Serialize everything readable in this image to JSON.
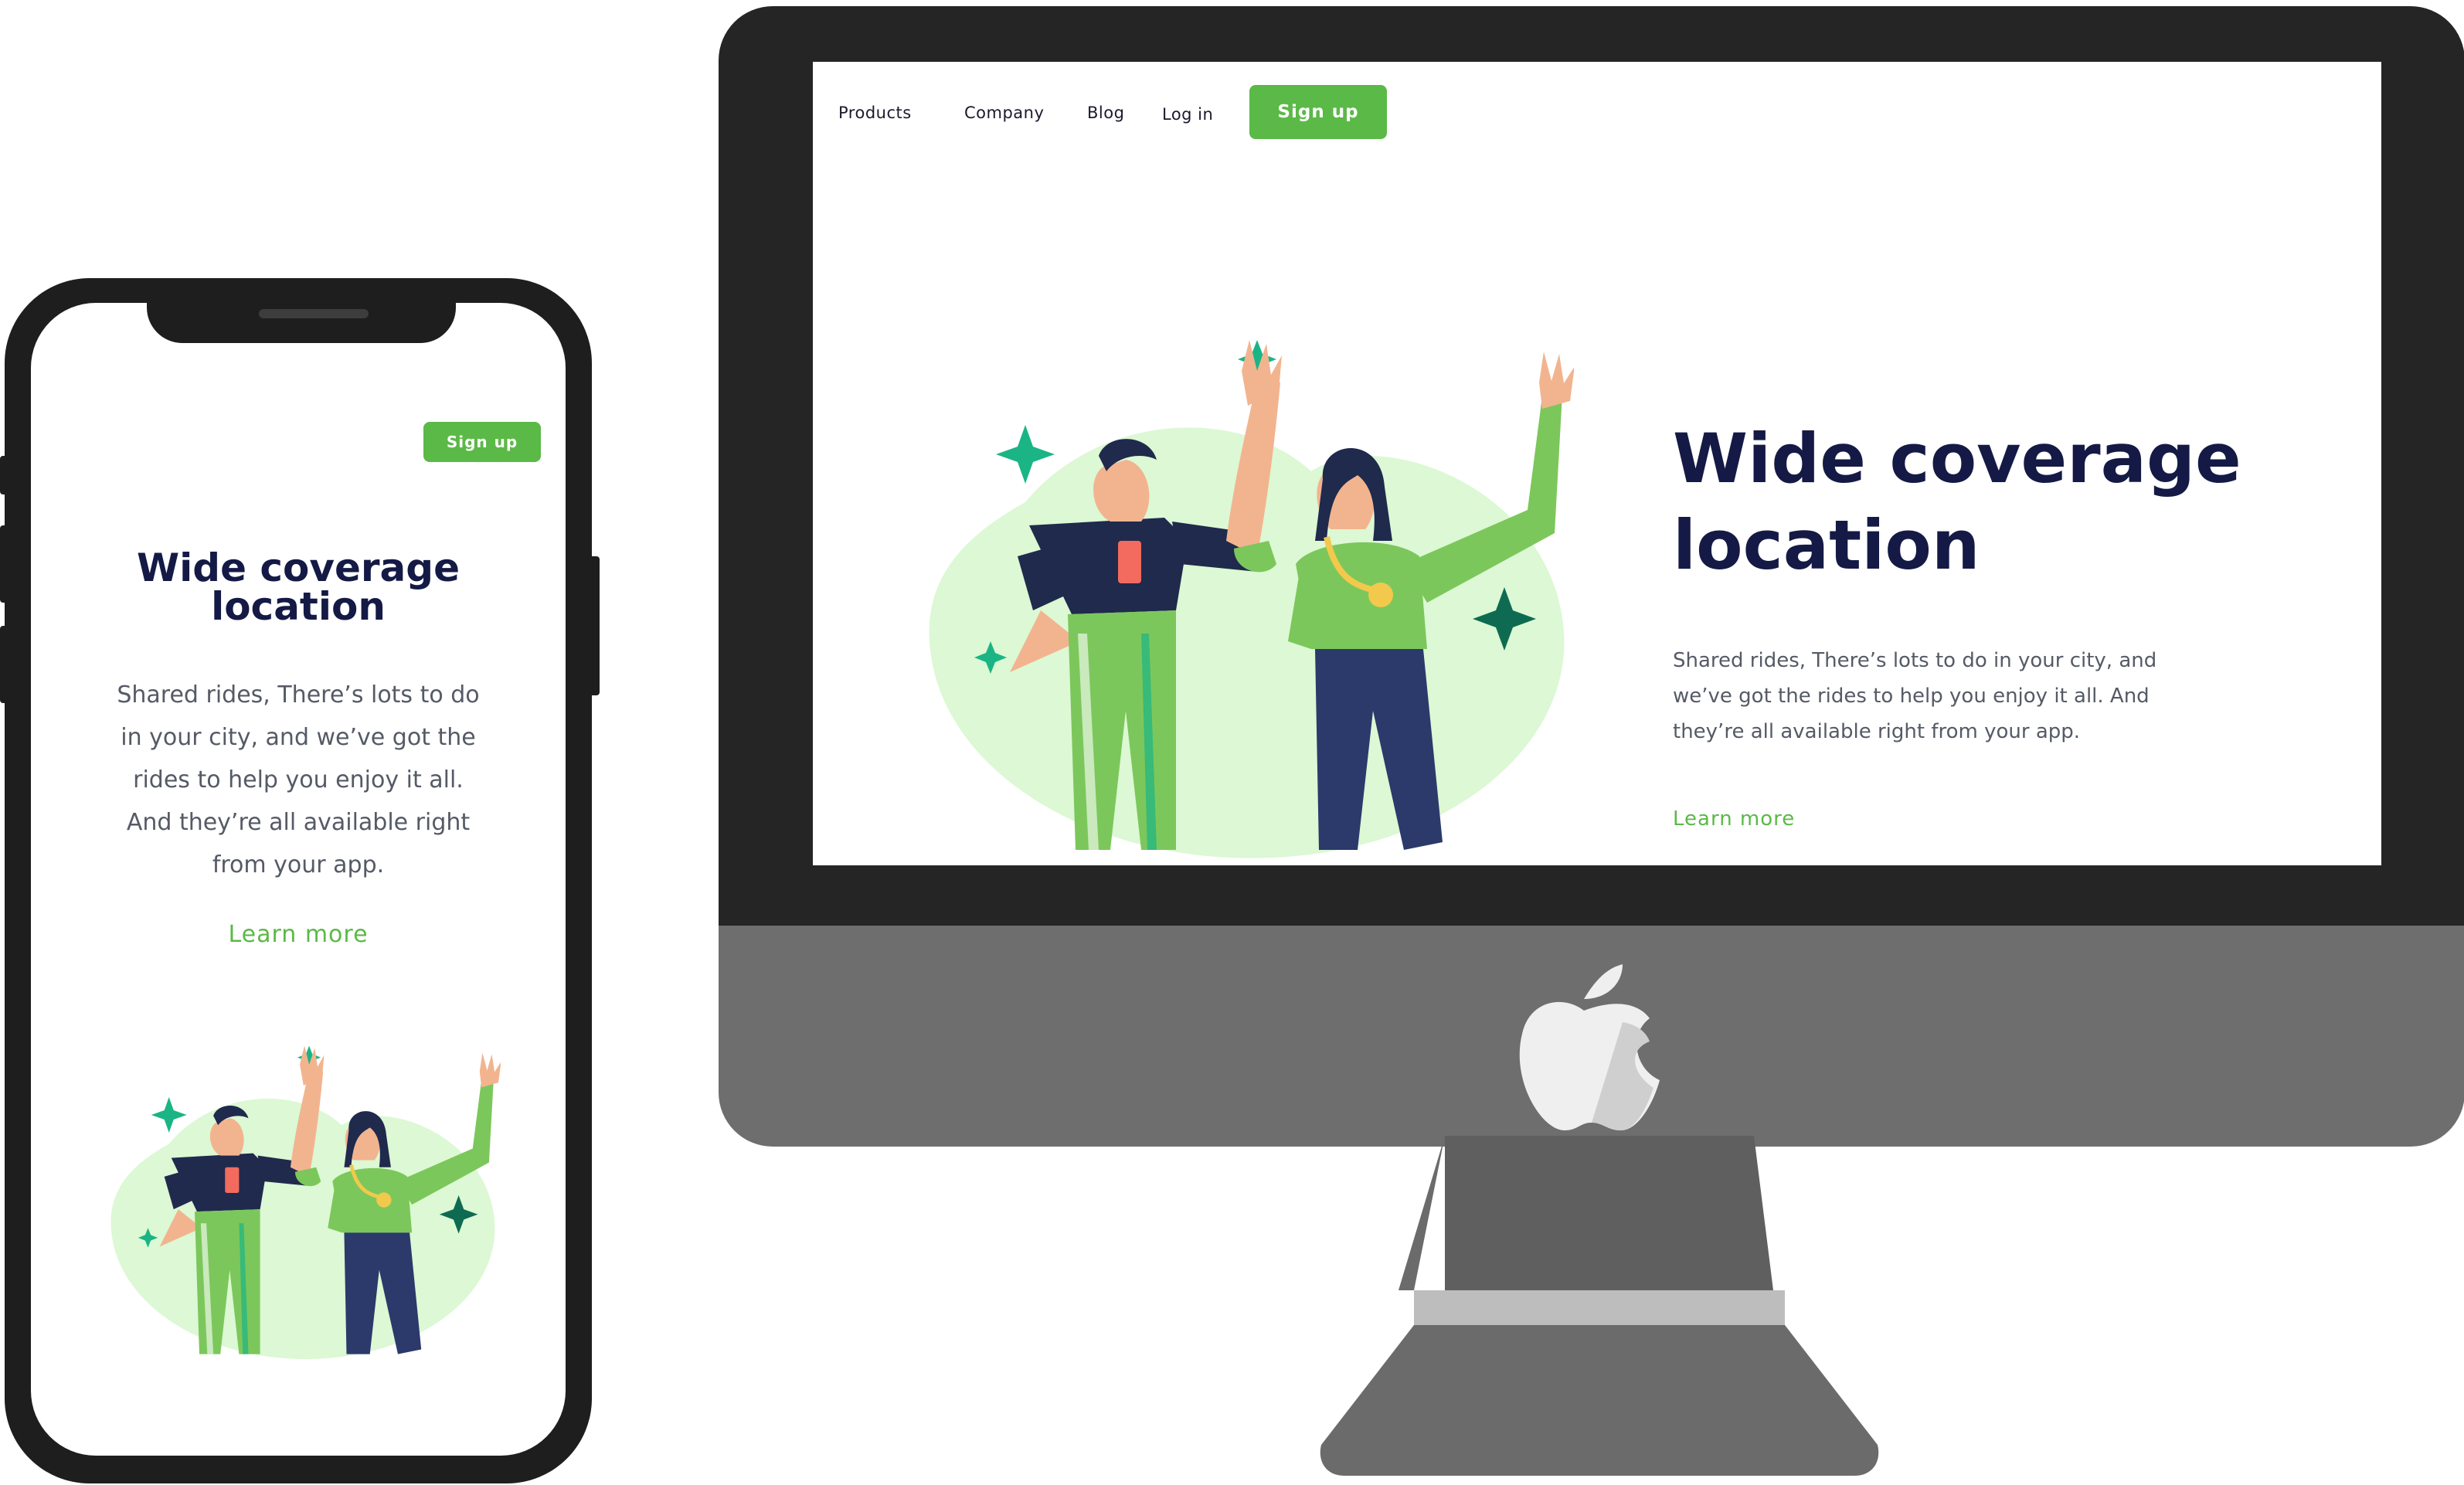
{
  "desktop": {
    "nav": {
      "products": "Products",
      "company": "Company",
      "blog": "Blog",
      "login": "Log in",
      "signup": "Sign up"
    },
    "hero": {
      "title_line1": "Wide coverage",
      "title_line2": "location",
      "desc_line1": "Shared rides, There’s lots to do in your city, and",
      "desc_line2": "we’ve got the rides to help you enjoy it all. And",
      "desc_line3": "they’re all available right from your app.",
      "learn_more": "Learn more"
    }
  },
  "mobile": {
    "signup": "Sign up",
    "hero": {
      "title_line1": "Wide coverage",
      "title_line2": "location",
      "desc_line1": "Shared rides, There’s lots to do",
      "desc_line2": "in your city, and we’ve got the",
      "desc_line3": "rides to help you enjoy it all.",
      "desc_line4": "And they’re all available right",
      "desc_line5": "from your app.",
      "learn_more": "Learn more"
    }
  },
  "colors": {
    "brand_green": "#5bb947",
    "navy": "#141a45",
    "blob": "#dcf8d4",
    "sparkle": "#1bb585"
  },
  "icons": {
    "device_logo": "apple-logo-icon"
  }
}
